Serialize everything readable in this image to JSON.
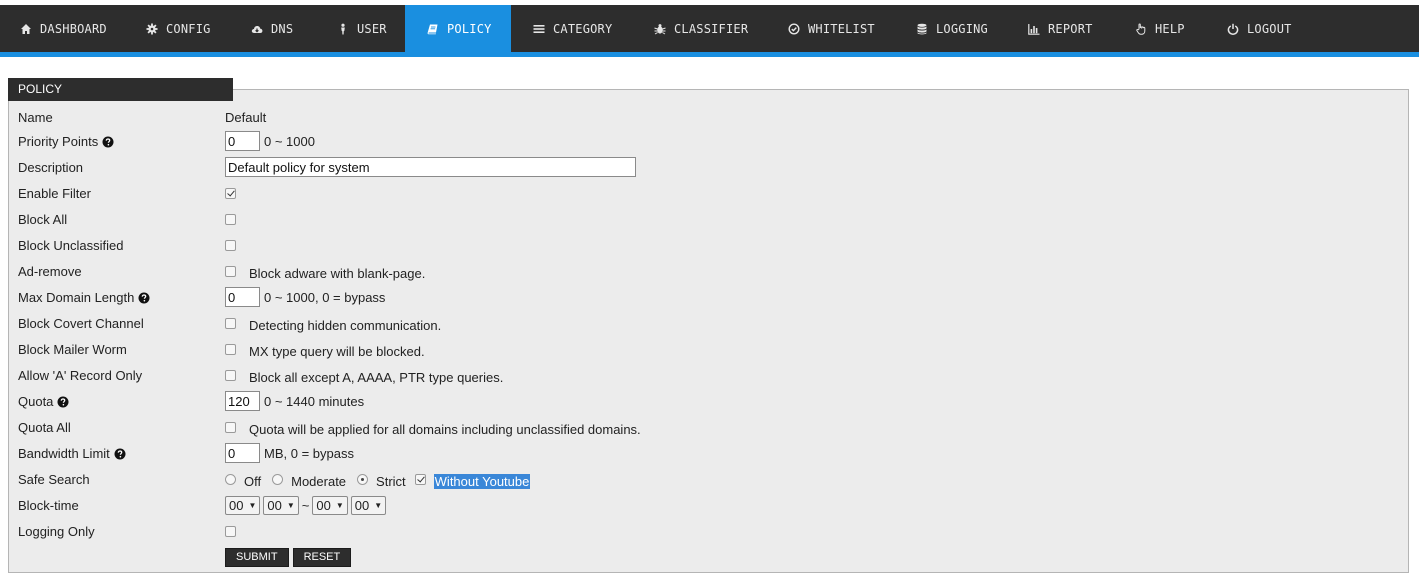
{
  "nav": {
    "items": [
      {
        "label": "DASHBOARD",
        "icon": "home-icon"
      },
      {
        "label": "CONFIG",
        "icon": "gear-icon"
      },
      {
        "label": "DNS",
        "icon": "cloud-download-icon"
      },
      {
        "label": "USER",
        "icon": "user-icon"
      },
      {
        "label": "POLICY",
        "icon": "book-icon"
      },
      {
        "label": "CATEGORY",
        "icon": "list-icon"
      },
      {
        "label": "CLASSIFIER",
        "icon": "bug-icon"
      },
      {
        "label": "WHITELIST",
        "icon": "check-circle-icon"
      },
      {
        "label": "LOGGING",
        "icon": "database-icon"
      },
      {
        "label": "REPORT",
        "icon": "bar-chart-icon"
      },
      {
        "label": "HELP",
        "icon": "hand-pointer-icon"
      },
      {
        "label": "LOGOUT",
        "icon": "power-icon"
      }
    ],
    "active": "POLICY"
  },
  "colors": {
    "navbar": "#2d2d2d",
    "accent": "#1a8fe0",
    "panel_bg": "#ececec",
    "highlight": "#3a87d8"
  },
  "panel": {
    "title": "POLICY"
  },
  "form": {
    "name": {
      "label": "Name",
      "value": "Default"
    },
    "priority_points": {
      "label": "Priority Points",
      "value": "0",
      "hint": "0 ~ 1000"
    },
    "description": {
      "label": "Description",
      "value": "Default policy for system"
    },
    "enable_filter": {
      "label": "Enable Filter",
      "checked": true
    },
    "block_all": {
      "label": "Block All",
      "checked": false
    },
    "block_unclassified": {
      "label": "Block Unclassified",
      "checked": false
    },
    "ad_remove": {
      "label": "Ad-remove",
      "checked": false,
      "text": "Block adware with blank-page."
    },
    "max_domain_length": {
      "label": "Max Domain Length",
      "value": "0",
      "hint": "0 ~ 1000, 0 = bypass"
    },
    "block_covert_channel": {
      "label": "Block Covert Channel",
      "checked": false,
      "text": "Detecting hidden communication."
    },
    "block_mailer_worm": {
      "label": "Block Mailer Worm",
      "checked": false,
      "text": "MX type query will be blocked."
    },
    "allow_a_record_only": {
      "label": "Allow 'A' Record Only",
      "checked": false,
      "text": "Block all except A, AAAA, PTR type queries."
    },
    "quota": {
      "label": "Quota",
      "value": "120",
      "hint": "0 ~ 1440 minutes"
    },
    "quota_all": {
      "label": "Quota All",
      "checked": false,
      "text": "Quota will be applied for all domains including unclassified domains."
    },
    "bandwidth_limit": {
      "label": "Bandwidth Limit",
      "value": "0",
      "hint": "MB, 0 = bypass"
    },
    "safe_search": {
      "label": "Safe Search",
      "options": [
        "Off",
        "Moderate",
        "Strict"
      ],
      "selected": "Strict",
      "without_youtube": {
        "label": "Without Youtube",
        "checked": true
      }
    },
    "block_time": {
      "label": "Block-time",
      "start_hour": "00",
      "start_min": "00",
      "separator": "~",
      "end_hour": "00",
      "end_min": "00"
    },
    "logging_only": {
      "label": "Logging Only",
      "checked": false
    },
    "submit_label": "SUBMIT",
    "reset_label": "RESET"
  }
}
